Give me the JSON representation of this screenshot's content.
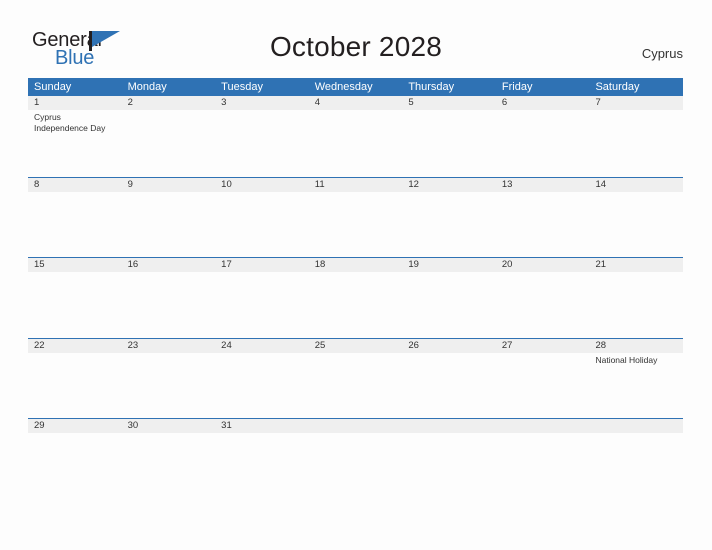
{
  "brand": {
    "name_part1": "General",
    "name_part2": "Blue",
    "flag_icon": "blue-triangle-flag-icon"
  },
  "header": {
    "title": "October 2028",
    "country": "Cyprus"
  },
  "colors": {
    "header_blue": "#2f72b4",
    "day_band_gray": "#efefef",
    "text": "#333333",
    "page_background": "#fdfdfd"
  },
  "calendar": {
    "weekdays": [
      "Sunday",
      "Monday",
      "Tuesday",
      "Wednesday",
      "Thursday",
      "Friday",
      "Saturday"
    ],
    "weeks": [
      [
        {
          "date": "1",
          "events": [
            "Cyprus",
            "Independence Day"
          ]
        },
        {
          "date": "2",
          "events": []
        },
        {
          "date": "3",
          "events": []
        },
        {
          "date": "4",
          "events": []
        },
        {
          "date": "5",
          "events": []
        },
        {
          "date": "6",
          "events": []
        },
        {
          "date": "7",
          "events": []
        }
      ],
      [
        {
          "date": "8",
          "events": []
        },
        {
          "date": "9",
          "events": []
        },
        {
          "date": "10",
          "events": []
        },
        {
          "date": "11",
          "events": []
        },
        {
          "date": "12",
          "events": []
        },
        {
          "date": "13",
          "events": []
        },
        {
          "date": "14",
          "events": []
        }
      ],
      [
        {
          "date": "15",
          "events": []
        },
        {
          "date": "16",
          "events": []
        },
        {
          "date": "17",
          "events": []
        },
        {
          "date": "18",
          "events": []
        },
        {
          "date": "19",
          "events": []
        },
        {
          "date": "20",
          "events": []
        },
        {
          "date": "21",
          "events": []
        }
      ],
      [
        {
          "date": "22",
          "events": []
        },
        {
          "date": "23",
          "events": []
        },
        {
          "date": "24",
          "events": []
        },
        {
          "date": "25",
          "events": []
        },
        {
          "date": "26",
          "events": []
        },
        {
          "date": "27",
          "events": []
        },
        {
          "date": "28",
          "events": [
            "National Holiday"
          ]
        }
      ],
      [
        {
          "date": "29",
          "events": []
        },
        {
          "date": "30",
          "events": []
        },
        {
          "date": "31",
          "events": []
        },
        {
          "date": "",
          "events": []
        },
        {
          "date": "",
          "events": []
        },
        {
          "date": "",
          "events": []
        },
        {
          "date": "",
          "events": []
        }
      ]
    ]
  }
}
